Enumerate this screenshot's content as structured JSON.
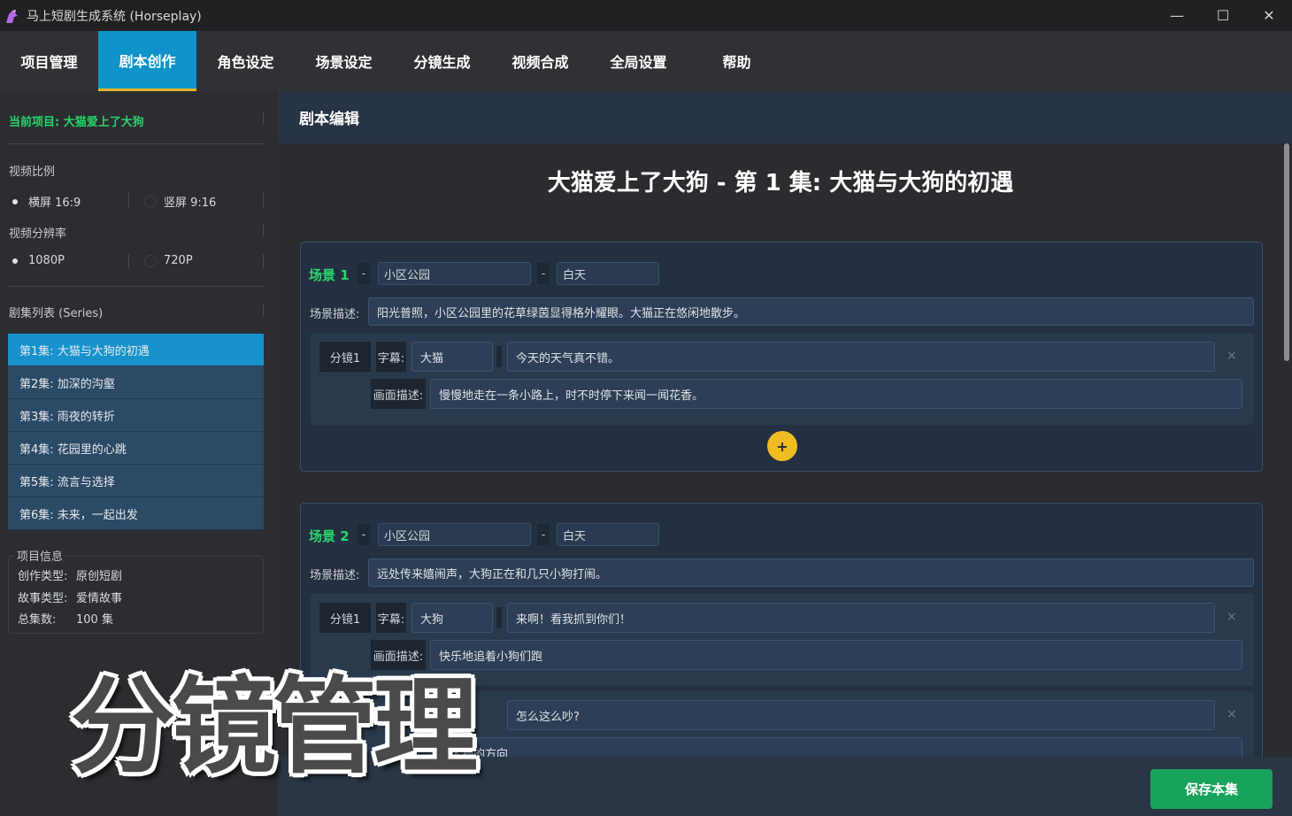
{
  "window": {
    "title": "马上短剧生成系统 (Horseplay)",
    "minimize": "—",
    "maximize": "☐",
    "close": "✕"
  },
  "menu": {
    "items": [
      "项目管理",
      "剧本创作",
      "角色设定",
      "场景设定",
      "分镜生成",
      "视频合成",
      "全局设置",
      "帮助"
    ],
    "active": "剧本创作"
  },
  "sidebar": {
    "current_project": "当前项目: 大猫爱上了大狗",
    "ratio_label": "视频比例",
    "ratio_options": [
      "横屏 16:9",
      "竖屏 9:16"
    ],
    "ratio_selected": "横屏 16:9",
    "resolution_label": "视频分辨率",
    "resolution_options": [
      "1080P",
      "720P"
    ],
    "resolution_selected": "1080P",
    "series_label": "剧集列表 (Series)",
    "episodes": [
      "第1集: 大猫与大狗的初遇",
      "第2集: 加深的沟壑",
      "第3集: 雨夜的转折",
      "第4集: 花园里的心跳",
      "第5集: 流言与选择",
      "第6集: 未来，一起出发"
    ],
    "info": {
      "title": "项目信息",
      "rows": [
        {
          "k": "创作类型:",
          "v": "原创短剧"
        },
        {
          "k": "故事类型:",
          "v": "爱情故事"
        },
        {
          "k": "总集数:",
          "v": "100 集"
        }
      ]
    }
  },
  "main": {
    "header": "剧本编辑",
    "episode_title": "大猫爱上了大狗 - 第 1 集: 大猫与大狗的初遇",
    "scene_desc_label": "场景描述:",
    "shot_sub_label": "字幕:",
    "shot_pic_label": "画面描述:",
    "dash": "-",
    "add": "+",
    "delete": "×",
    "scenes": [
      {
        "label": "场景 1",
        "location": "小区公园",
        "time": "白天",
        "desc": "阳光普照，小区公园里的花草绿茵显得格外耀眼。大猫正在悠闲地散步。",
        "shots": [
          {
            "tag": "分镜1",
            "speaker": "大猫",
            "line": "今天的天气真不错。",
            "picture": "慢慢地走在一条小路上，时不时停下来闻一闻花香。"
          }
        ]
      },
      {
        "label": "场景 2",
        "location": "小区公园",
        "time": "白天",
        "desc": "远处传来嬉闹声，大狗正在和几只小狗打闹。",
        "shots": [
          {
            "tag": "分镜1",
            "speaker": "大狗",
            "line": "来啊！看我抓到你们！",
            "picture": "快乐地追着小狗们跑"
          },
          {
            "tag": "",
            "speaker": "",
            "line": "怎么这么吵?",
            "picture": "向大狗的方向"
          }
        ]
      }
    ],
    "save_button": "保存本集"
  },
  "overlay": {
    "text": "分镜管理"
  },
  "colors": {
    "accent": "#0f93c9",
    "active_underline": "#e1b32a",
    "green": "#2bd66a",
    "save": "#18a35b",
    "add": "#efbc21"
  }
}
